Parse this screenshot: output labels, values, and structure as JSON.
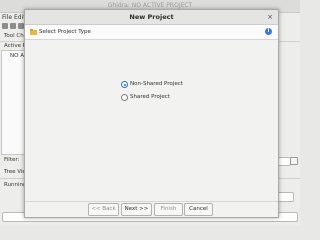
{
  "main_window": {
    "title": "Ghidra: NO ACTIVE PROJECT",
    "menu": [
      "File",
      "Edit"
    ],
    "panels": {
      "tool_chest_label": "Tool Che",
      "active_project_label": "Active P",
      "no_active_label": "NO AC",
      "filter_label": "Filter:",
      "tree_view_label": "Tree Vie",
      "running_tools_label": "Running"
    }
  },
  "dialog": {
    "title": "New Project",
    "close_glyph": "×",
    "subtitle": "Select Project Type",
    "options": [
      {
        "label": "Non-Shared Project",
        "selected": true
      },
      {
        "label": "Shared Project",
        "selected": false
      }
    ],
    "buttons": {
      "back": "<< Back",
      "next": "Next >>",
      "finish": "Finish",
      "cancel": "Cancel"
    },
    "info_glyph": "i"
  },
  "colors": {
    "accent": "#2f6fd1",
    "info": "#3b78d8"
  }
}
